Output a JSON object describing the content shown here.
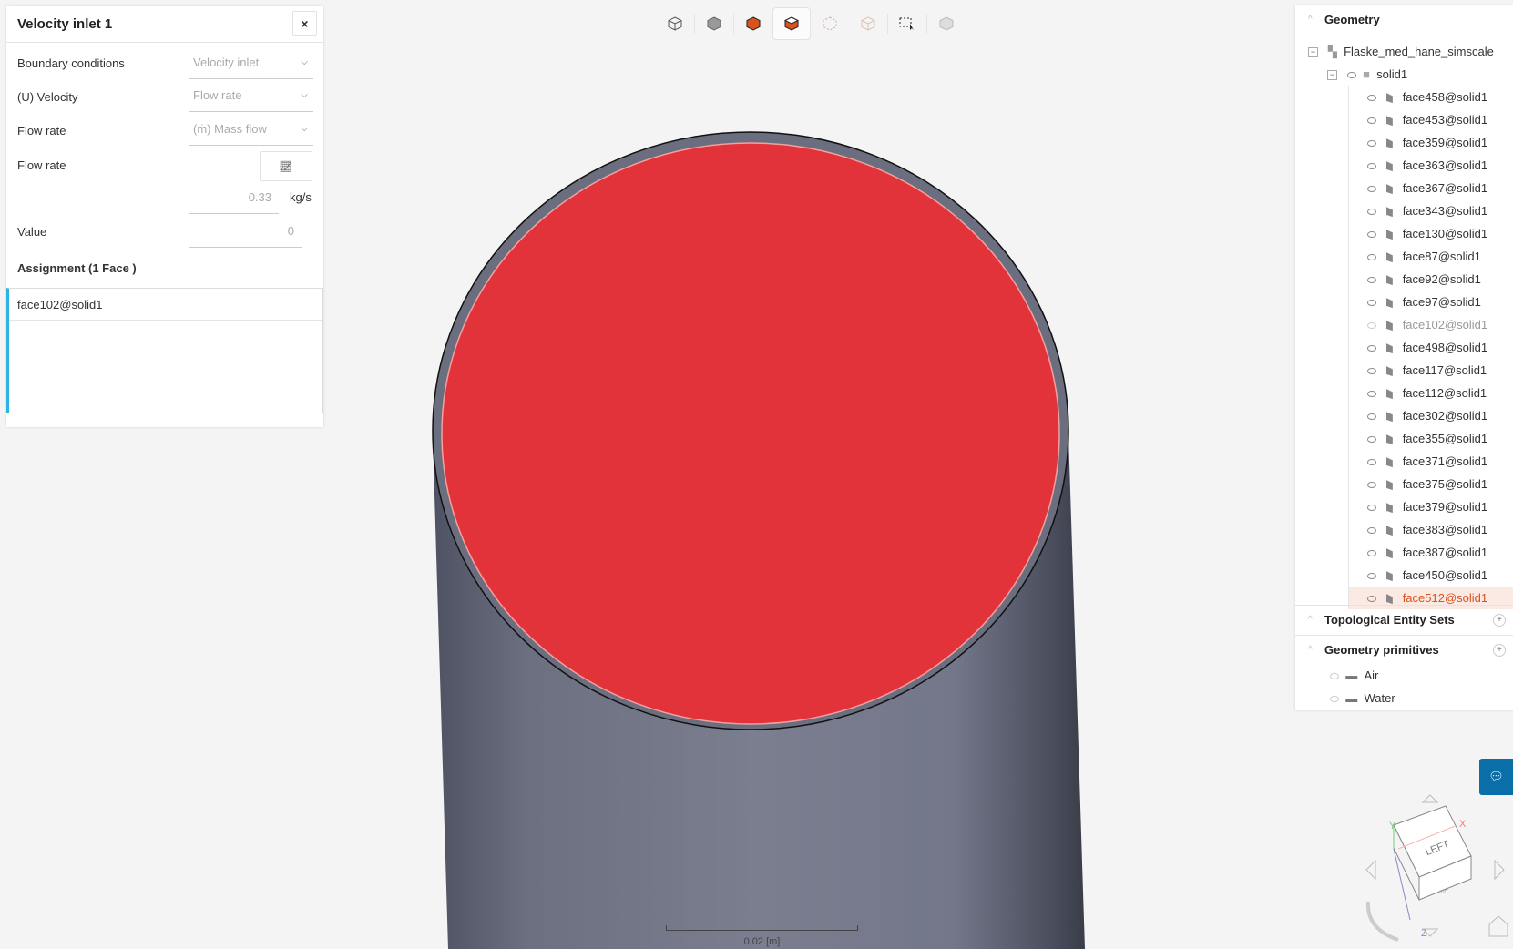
{
  "panel": {
    "title": "Velocity inlet 1",
    "close_icon": "×",
    "fields": [
      {
        "label": "Boundary conditions",
        "value": "Velocity inlet"
      },
      {
        "label": "(U) Velocity",
        "value": "Flow rate"
      },
      {
        "label": "Flow rate",
        "value": "(ṁ) Mass flow"
      }
    ],
    "flow_rate_label": "Flow rate",
    "flow_rate_value": "0.33",
    "flow_rate_unit": "kg/s",
    "value_label": "Value",
    "value_value": "0",
    "assignment_title": "Assignment (1 Face )",
    "assigned": [
      "face102@solid1"
    ]
  },
  "toolbar": [
    "wireframe-view",
    "solid-view",
    "select-solid",
    "select-face",
    "select-edge",
    "select-vertex",
    "box-select",
    "hide-selection"
  ],
  "tree": {
    "geometry_title": "Geometry",
    "root": "Flaske_med_hane_simscale",
    "solid": "solid1",
    "faces": [
      "face458@solid1",
      "face453@solid1",
      "face359@solid1",
      "face363@solid1",
      "face367@solid1",
      "face343@solid1",
      "face130@solid1",
      "face87@solid1",
      "face92@solid1",
      "face97@solid1",
      "face102@solid1",
      "face498@solid1",
      "face117@solid1",
      "face112@solid1",
      "face302@solid1",
      "face355@solid1",
      "face371@solid1",
      "face375@solid1",
      "face379@solid1",
      "face383@solid1",
      "face387@solid1",
      "face450@solid1",
      "face512@solid1"
    ],
    "hidden_face": "face102@solid1",
    "selected_face": "face512@solid1",
    "topo_title": "Topological Entity Sets",
    "prim_title": "Geometry primitives",
    "primitives": [
      "Air",
      "Water"
    ]
  },
  "viewer": {
    "scale_label": "0.02 [m]",
    "cube_front": "LEFT",
    "cube_bottom": "TOP",
    "axis_x": "X",
    "axis_y": "Y",
    "axis_z": "Z",
    "highlight_color": "#e3333a"
  }
}
